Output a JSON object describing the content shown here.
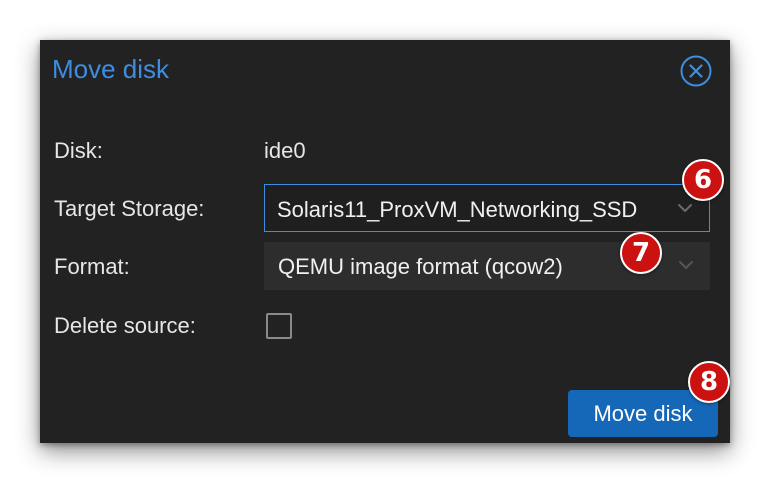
{
  "dialog": {
    "title": "Move disk",
    "close_icon": "close-circle-icon",
    "disk": {
      "label": "Disk:",
      "value": "ide0"
    },
    "target_storage": {
      "label": "Target Storage:",
      "value": "Solaris11_ProxVM_Networking_SSD"
    },
    "format": {
      "label": "Format:",
      "value": "QEMU image format (qcow2)"
    },
    "delete_source": {
      "label": "Delete source:",
      "checked": false
    },
    "submit_label": "Move disk"
  },
  "callouts": [
    "6",
    "7",
    "8"
  ],
  "colors": {
    "dialog_bg": "#222222",
    "title": "#3d8ee0",
    "focus_border": "#3d8ee0",
    "primary_button": "#1567b8",
    "callout": "#cc1111"
  }
}
